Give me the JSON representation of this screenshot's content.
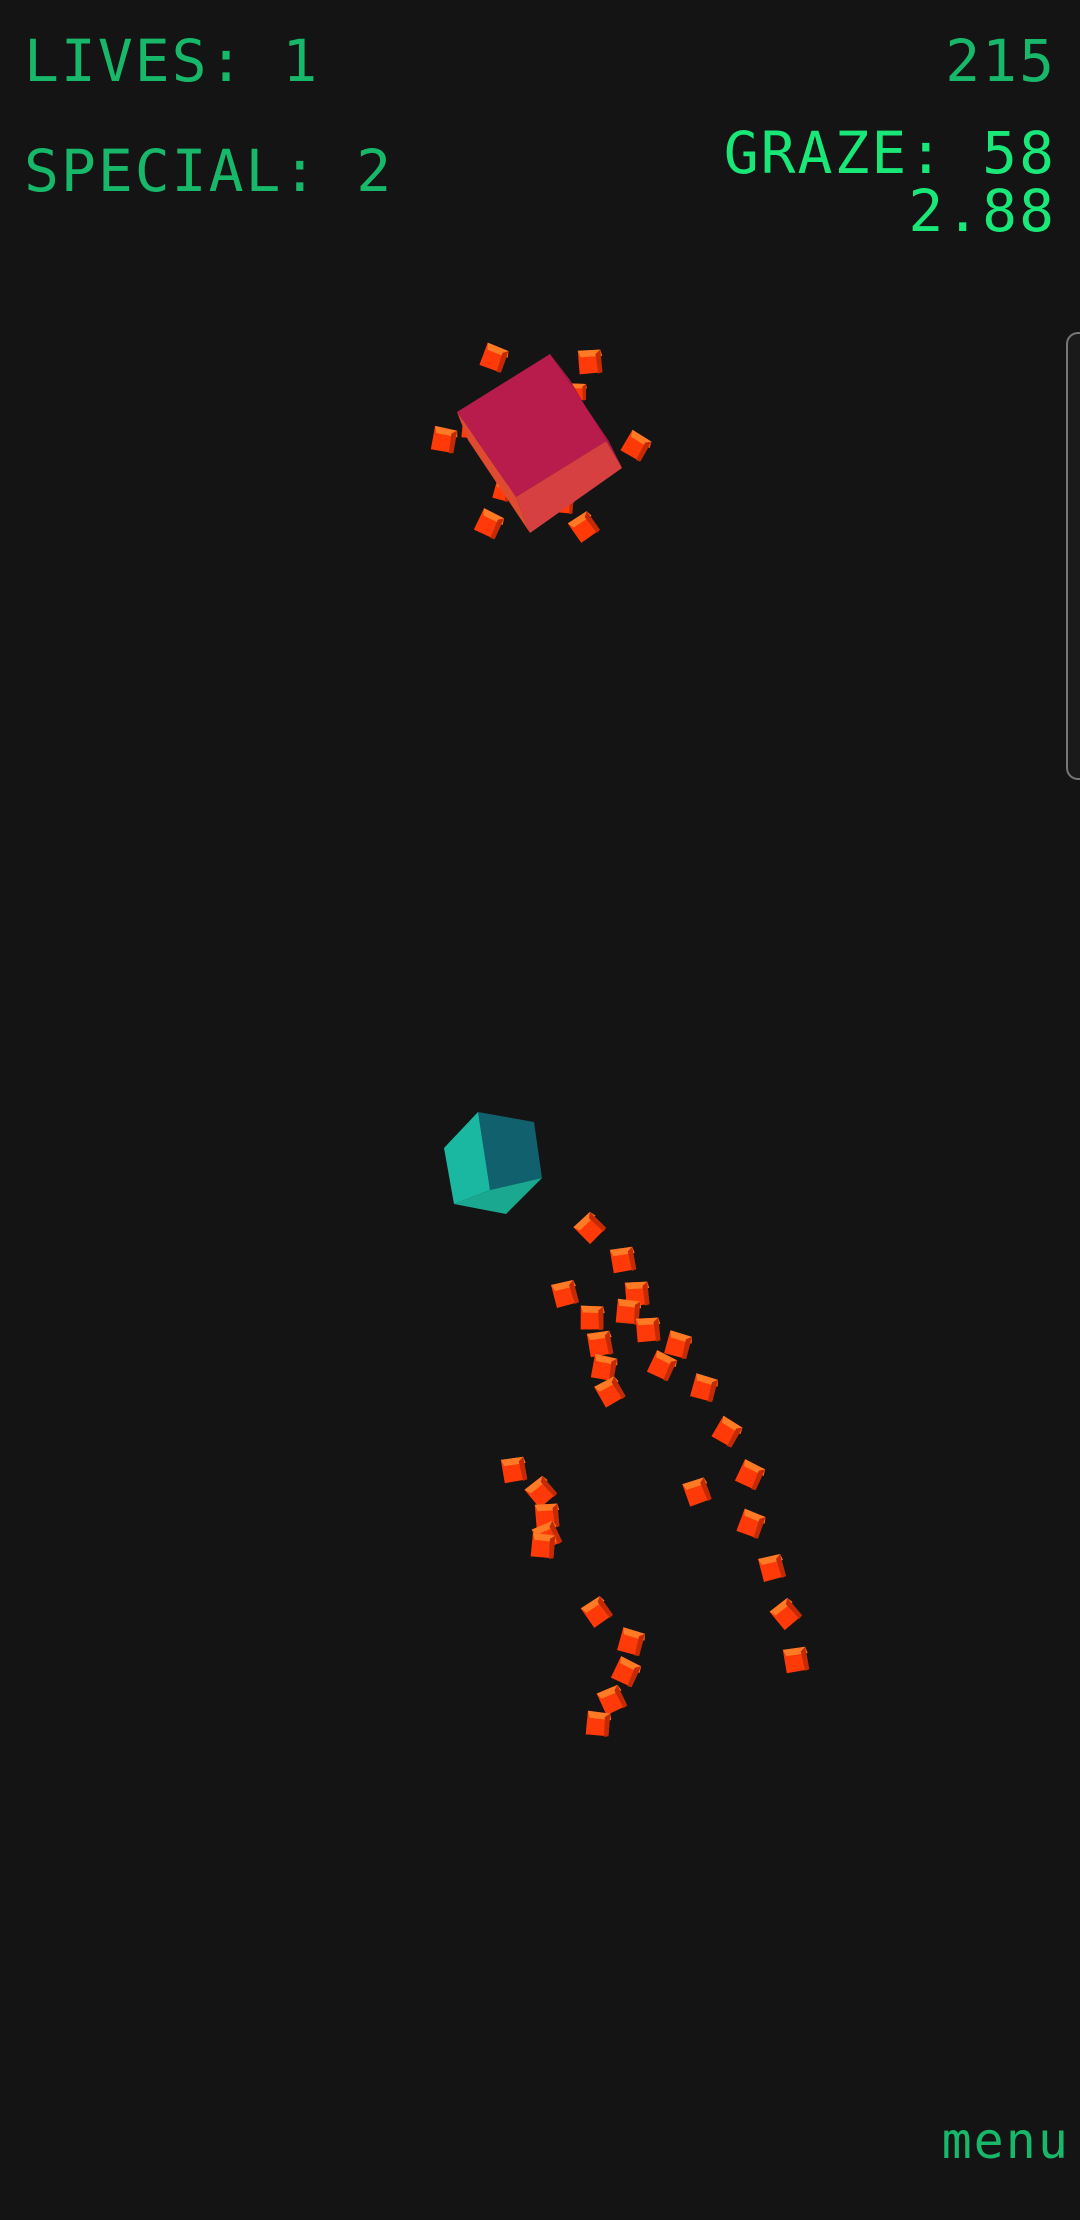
{
  "hud": {
    "lives": "LIVES: 1",
    "special": "SPECIAL: 2",
    "score": "215",
    "graze": "GRAZE: 58",
    "multiplier": "2.88"
  },
  "menu": {
    "label": "menu"
  },
  "colors": {
    "hud_text": "#17b86a",
    "hud_text_bright": "#19e878",
    "background": "#141414",
    "enemy_top": "#b81c4c",
    "enemy_side": "#d64040",
    "player_top": "#10606e",
    "player_side": "#1aa890",
    "bullet": "#ff3a08"
  },
  "icons": {
    "player": "teal-cube-player-ship",
    "enemy": "crimson-cube-boss-enemy",
    "bullet": "orange-cube-bullet"
  }
}
